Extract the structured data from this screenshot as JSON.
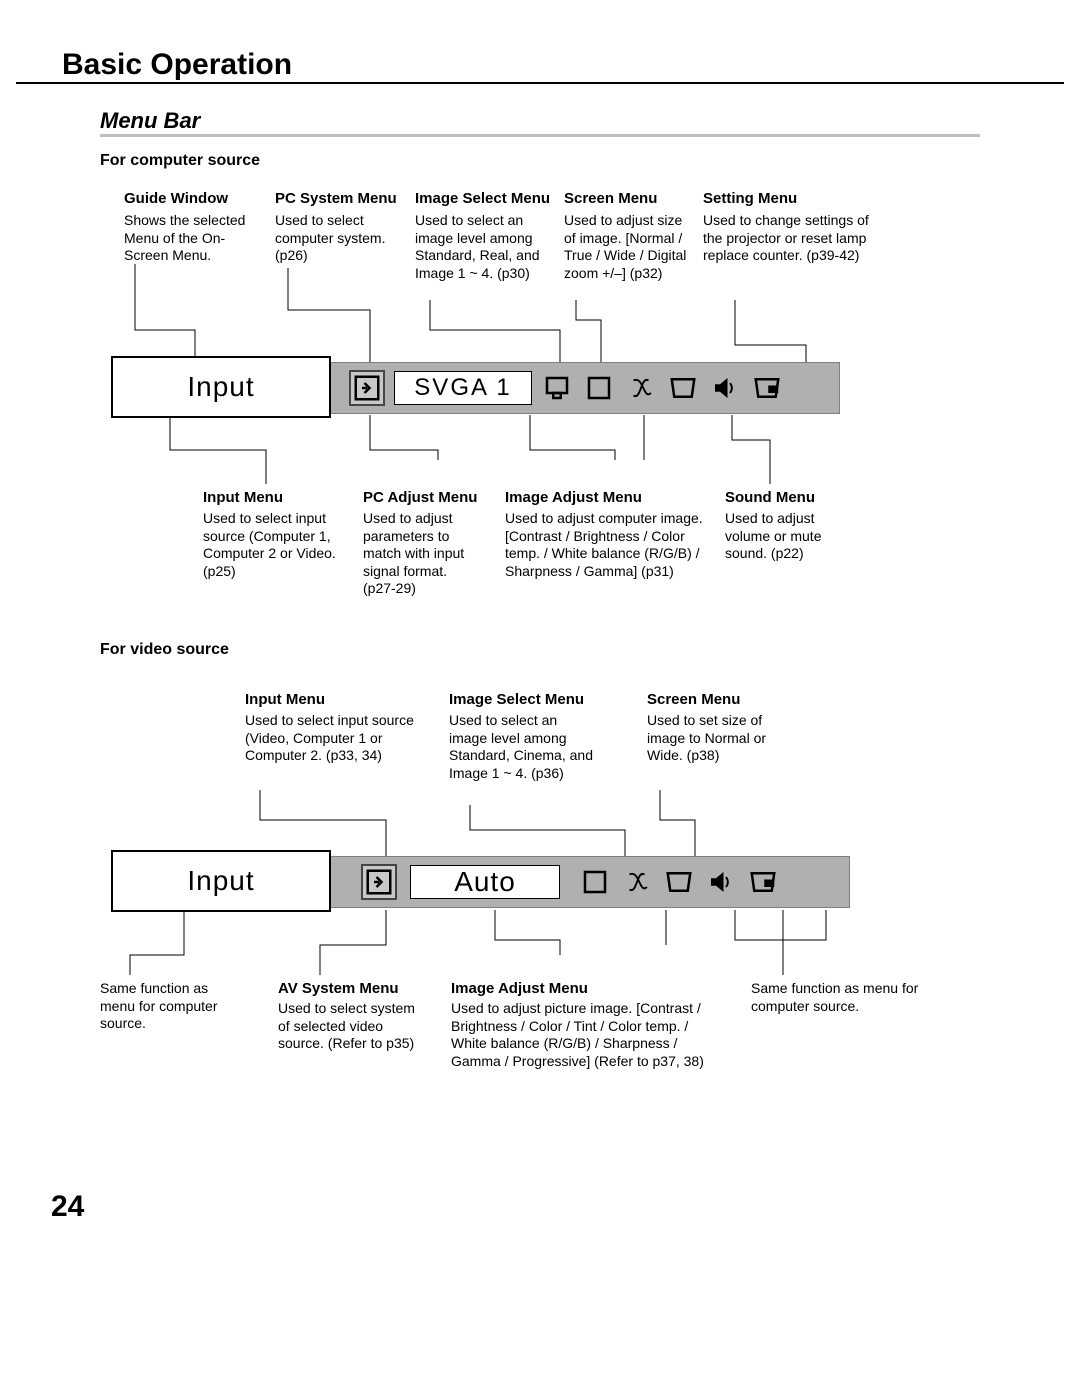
{
  "page_title": "Basic Operation",
  "section_title": "Menu Bar",
  "page_number": "24",
  "computer": {
    "heading": "For computer source",
    "menubar_input_label": "Input",
    "menubar_system_label": "SVGA 1",
    "top": [
      {
        "title": "Guide Window",
        "desc": "Shows the selected Menu of the On-Screen Menu."
      },
      {
        "title": "PC System Menu",
        "desc": "Used to select computer system. (p26)"
      },
      {
        "title": "Image Select Menu",
        "desc": "Used to select  an image level among Standard, Real, and Image 1 ~ 4. (p30)"
      },
      {
        "title": "Screen Menu",
        "desc": "Used to adjust size of image.  [Normal / True / Wide / Digital zoom +/–] (p32)"
      },
      {
        "title": "Setting Menu",
        "desc": "Used to change settings of the projector or reset  lamp replace counter.   (p39-42)"
      }
    ],
    "bottom": [
      {
        "title": "Input Menu",
        "desc": "Used to select input source (Computer 1, Computer 2 or Video. (p25)"
      },
      {
        "title": "PC Adjust Menu",
        "desc": "Used to adjust parameters to match with input signal format. (p27-29)"
      },
      {
        "title": "Image Adjust Menu",
        "desc": "Used to adjust computer image. [Contrast / Brightness / Color temp. /  White balance (R/G/B) / Sharpness /  Gamma]   (p31)"
      },
      {
        "title": "Sound Menu",
        "desc": "Used to adjust volume or mute sound.  (p22)"
      }
    ]
  },
  "video": {
    "heading": "For video source",
    "menubar_input_label": "Input",
    "menubar_system_label": "Auto",
    "top": [
      {
        "title": "Input Menu",
        "desc": "Used to select input source (Video, Computer 1 or Computer 2.     (p33, 34)"
      },
      {
        "title": "Image Select Menu",
        "desc": "Used to select an image level among Standard, Cinema, and Image 1 ~ 4. (p36)"
      },
      {
        "title": "Screen Menu",
        "desc": "Used to set size of image to Normal or Wide. (p38)"
      }
    ],
    "bottom_left_note": "Same function as menu for computer source.",
    "bottom": [
      {
        "title": "AV System Menu",
        "desc": "Used to select system of selected video source. (Refer to p35)"
      },
      {
        "title": "Image Adjust Menu",
        "desc": " Used to adjust picture image. [Contrast / Brightness / Color / Tint / Color temp. / White balance (R/G/B) / Sharpness /  Gamma / Progressive] (Refer to p37, 38)"
      }
    ],
    "bottom_right_note": "Same function as menu for computer source."
  }
}
